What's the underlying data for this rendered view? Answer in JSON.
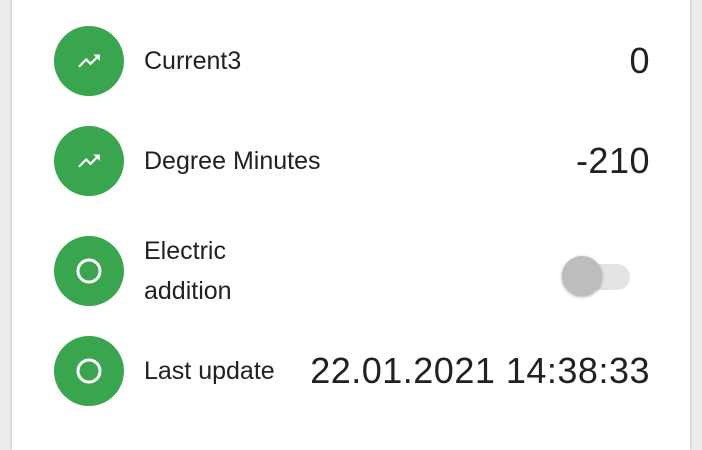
{
  "colors": {
    "accent": "#3aa54f",
    "icon": "#ffffff"
  },
  "rows": [
    {
      "icon": "trending-up-icon",
      "label": "Current3",
      "value": "0"
    },
    {
      "icon": "trending-up-icon",
      "label": "Degree Minutes",
      "value": "-210"
    },
    {
      "icon": "circle-outline-icon",
      "label": "Electric addition",
      "toggle_on": false
    },
    {
      "icon": "circle-outline-icon",
      "label": "Last update",
      "value": "22.01.2021 14:38:33"
    }
  ]
}
